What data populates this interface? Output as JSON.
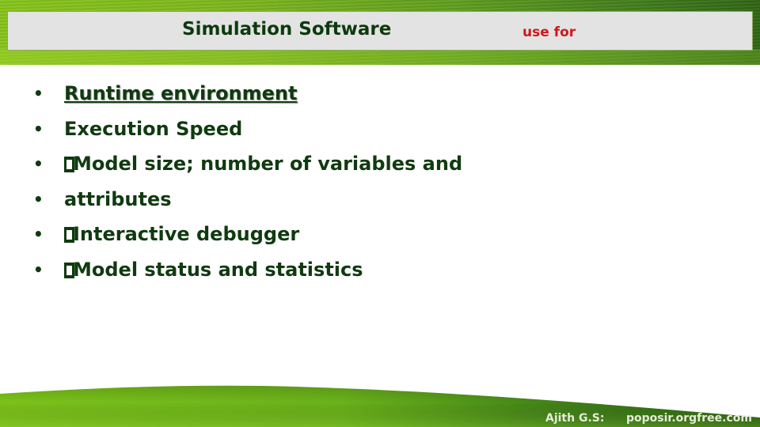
{
  "slide": {
    "title": "Simulation Software",
    "subtitle": "use for",
    "bullets": [
      {
        "text": "Runtime environment",
        "missing_glyph": false,
        "underlined": true
      },
      {
        "text": "Execution Speed",
        "missing_glyph": false,
        "underlined": false
      },
      {
        "text": "Model size; number of variables and",
        "missing_glyph": true,
        "underlined": false
      },
      {
        "text": "attributes",
        "missing_glyph": false,
        "underlined": false
      },
      {
        "text": "Interactive debugger",
        "missing_glyph": true,
        "underlined": false
      },
      {
        "text": "Model status and statistics",
        "missing_glyph": true,
        "underlined": false
      }
    ],
    "bullet_glyph": "•",
    "footer": {
      "author": "Ajith G.S:",
      "site": "poposir.orgfree.com"
    }
  },
  "colors": {
    "title": "#0d3a0d",
    "subtitle": "#cc1a1a",
    "body_text": "#103a10",
    "title_box": "#e3e3e3",
    "grass_light": "#86c31a",
    "grass_dark": "#2f6414"
  }
}
